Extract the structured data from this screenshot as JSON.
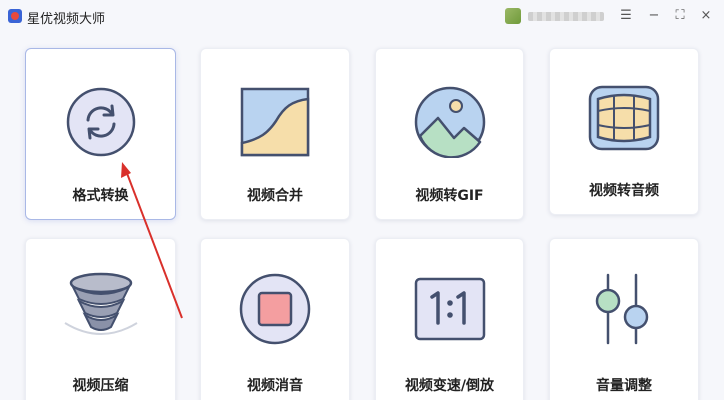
{
  "app": {
    "title": "星优视频大师"
  },
  "window": {
    "minimize": "−",
    "maximize": "⛶",
    "close": "×",
    "menu": "☰"
  },
  "tools": [
    {
      "label": "格式转换",
      "icon": "refresh-convert-icon"
    },
    {
      "label": "视频合并",
      "icon": "curve-merge-icon"
    },
    {
      "label": "视频转GIF",
      "icon": "image-landscape-icon"
    },
    {
      "label": "视频转音频",
      "icon": "sound-grid-icon"
    },
    {
      "label": "视频压缩",
      "icon": "tornado-compress-icon"
    },
    {
      "label": "视频消音",
      "icon": "stop-mute-icon"
    },
    {
      "label": "视频变速/倒放",
      "icon": "ratio-speed-icon"
    },
    {
      "label": "音量调整",
      "icon": "slider-volume-icon"
    }
  ],
  "colors": {
    "accent": "#3a64d6",
    "arrow": "#d9302b",
    "iconStroke": "#44506e"
  }
}
